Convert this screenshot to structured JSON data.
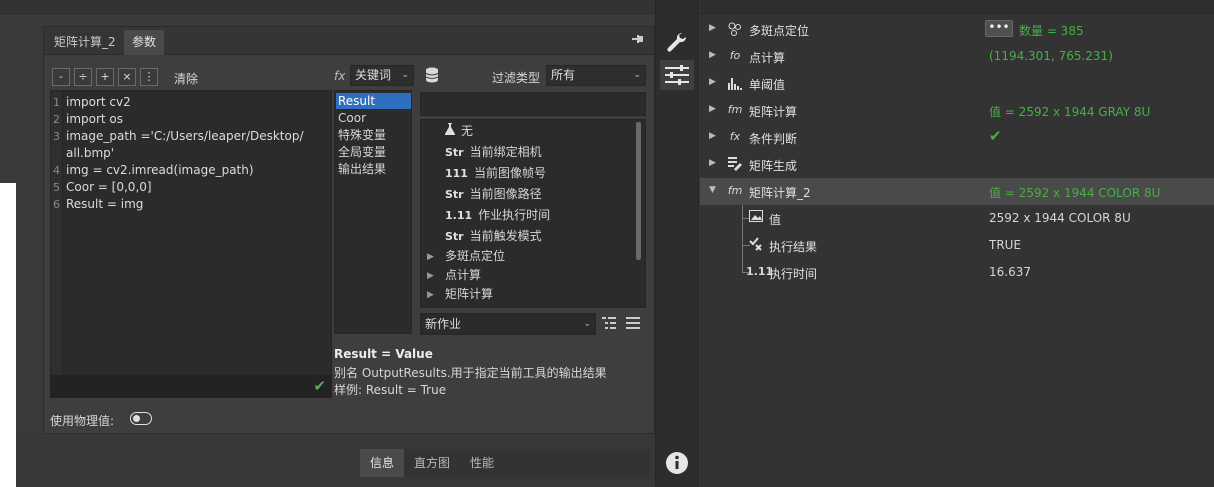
{
  "dialog": {
    "tabs": [
      "矩阵计算_2",
      "参数"
    ],
    "toolbar": {
      "buttons": [
        "-",
        "÷",
        "+",
        "×",
        "⋮"
      ],
      "clear_label": "清除"
    },
    "code_lines": [
      {
        "num": "1",
        "text": "import cv2"
      },
      {
        "num": "2",
        "text": "import os"
      },
      {
        "num": "3",
        "text": "image_path ='C:/Users/leaper/Desktop/"
      },
      {
        "num": "",
        "text": "all.bmp'"
      },
      {
        "num": "4",
        "text": "img = cv2.imread(image_path)"
      },
      {
        "num": "5",
        "text": "Coor = [0,0,0]"
      },
      {
        "num": "6",
        "text": "Result = img"
      }
    ],
    "physical_value_label": "使用物理值:",
    "fx_label": "fx",
    "keyword_select": "关键词",
    "filter_label": "过滤类型",
    "filter_select": "所有",
    "keywords": [
      "Result",
      "Coor",
      "特殊变量",
      "全局变量",
      "输出结果"
    ],
    "selected_keyword": "Result",
    "tree_items": [
      {
        "icon": "flask",
        "badge": "",
        "label": "无"
      },
      {
        "icon": "",
        "badge": "Str",
        "label": "当前绑定相机"
      },
      {
        "icon": "",
        "badge": "111",
        "label": "当前图像帧号"
      },
      {
        "icon": "",
        "badge": "Str",
        "label": "当前图像路径"
      },
      {
        "icon": "",
        "badge": "1.11",
        "label": "作业执行时间"
      },
      {
        "icon": "",
        "badge": "Str",
        "label": "当前触发模式"
      },
      {
        "icon": "",
        "badge": "",
        "label": "多斑点定位"
      },
      {
        "icon": "",
        "badge": "",
        "label": "点计算"
      },
      {
        "icon": "",
        "badge": "",
        "label": "矩阵计算"
      }
    ],
    "job_select": "新作业",
    "help": {
      "title": "Result = Value",
      "alias": "别名 OutputResults.用于指定当前工具的输出结果",
      "example": "样例:  Result = True"
    }
  },
  "bottom_tabs": [
    "信息",
    "直方图",
    "性能"
  ],
  "right_panel": {
    "rows": [
      {
        "name": "多斑点定位",
        "icon": "blob-icon",
        "value": "数量 = 385",
        "green": true,
        "has_more_button": true
      },
      {
        "name": "点计算",
        "icon": "fx-icon",
        "value": "(1194.301, 765.231)",
        "green": true
      },
      {
        "name": "单阈值",
        "icon": "histogram-icon",
        "value": "",
        "green": false
      },
      {
        "name": "矩阵计算",
        "icon": "matrix-fx-icon",
        "value": "值 = 2592 x 1944 GRAY 8U",
        "green": true
      },
      {
        "name": "条件判断",
        "icon": "condition-icon",
        "value": "✔",
        "green": true
      },
      {
        "name": "矩阵生成",
        "icon": "matrix-gen-icon",
        "value": "",
        "green": false
      },
      {
        "name": "矩阵计算_2",
        "icon": "matrix-fx-icon",
        "value": "值 = 2592 x 1944 COLOR 8U",
        "green": true,
        "selected": true,
        "expanded": true
      }
    ],
    "children": [
      {
        "name": "值",
        "badge": "image",
        "value": "2592 x 1944 COLOR 8U"
      },
      {
        "name": "执行结果",
        "badge": "check",
        "value": "TRUE"
      },
      {
        "name": "执行时间",
        "badge": "1.11",
        "value": "16.637"
      }
    ]
  },
  "colors": {
    "accent": "#2f6fc0",
    "ok_green": "#45b045"
  }
}
